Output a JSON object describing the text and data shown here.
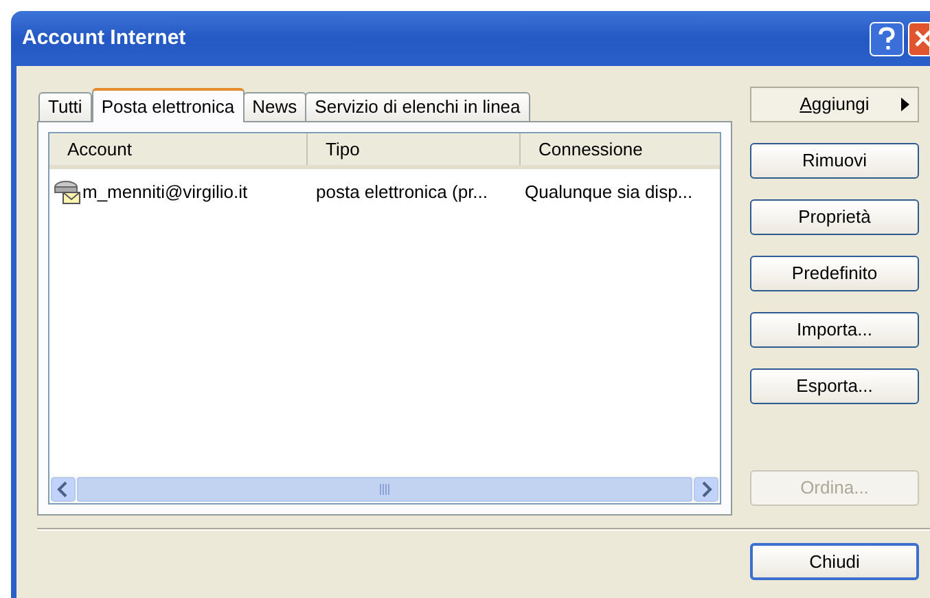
{
  "window": {
    "title": "Account Internet"
  },
  "tabs": [
    {
      "label": "Tutti",
      "selected": false
    },
    {
      "label": "Posta elettronica",
      "selected": true
    },
    {
      "label": "News",
      "selected": false
    },
    {
      "label": "Servizio di elenchi in linea",
      "selected": false
    }
  ],
  "list": {
    "columns": [
      "Account",
      "Tipo",
      "Connessione"
    ],
    "rows": [
      {
        "cells": [
          "m_menniti@virgilio.it",
          "posta elettronica (pr...",
          "Qualunque sia disp..."
        ],
        "selected": false
      }
    ]
  },
  "side_buttons": [
    {
      "label": "Aggiungi",
      "submenu": true,
      "accelerator": true,
      "disabled": false
    },
    {
      "label": "Rimuovi",
      "submenu": false,
      "accelerator": false,
      "disabled": false
    },
    {
      "label": "Proprietà",
      "submenu": false,
      "accelerator": false,
      "disabled": false
    },
    {
      "label": "Predefinito",
      "submenu": false,
      "accelerator": false,
      "disabled": false
    },
    {
      "label": "Importa...",
      "submenu": false,
      "accelerator": false,
      "disabled": false
    },
    {
      "label": "Esporta...",
      "submenu": false,
      "accelerator": false,
      "disabled": false
    },
    {
      "label": "Ordina...",
      "submenu": false,
      "accelerator": false,
      "disabled": true
    }
  ],
  "footer_buttons": [
    {
      "label": "Chiudi",
      "default": true
    }
  ]
}
